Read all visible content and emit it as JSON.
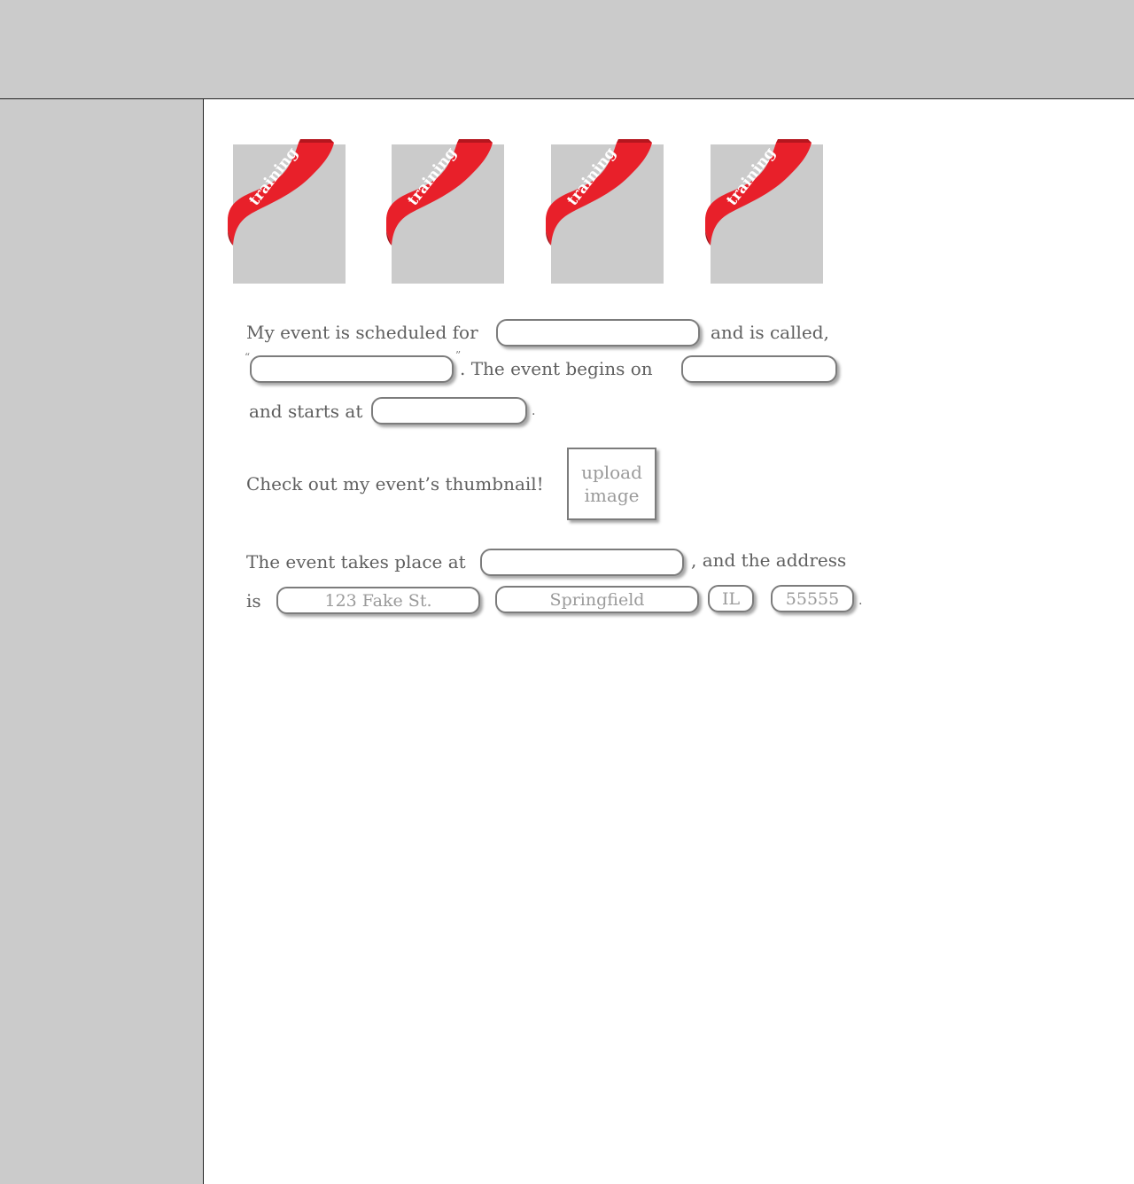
{
  "cards": [
    {
      "ribbon_label": "training",
      "ribbon_color": "#e8202a"
    },
    {
      "ribbon_label": "training",
      "ribbon_color": "#e8202a"
    },
    {
      "ribbon_label": "training",
      "ribbon_color": "#e8202a"
    },
    {
      "ribbon_label": "training",
      "ribbon_color": "#e8202a"
    }
  ],
  "form": {
    "line1_prefix": "My event is scheduled for",
    "line1_suffix": "and is called,",
    "open_quote": "“",
    "close_quote": "”",
    "line2_mid": ". The event begins on",
    "line3_prefix": "and starts at",
    "period": ".",
    "thumbnail_label": "Check out my event’s thumbnail!",
    "upload_line1": "upload",
    "upload_line2": "image",
    "location_prefix": "The event takes place at",
    "location_suffix": ", and the address",
    "address_prefix": "is",
    "street_placeholder": "123 Fake St.",
    "city_placeholder": "Springfield",
    "state_placeholder": "IL",
    "zip_placeholder": "55555"
  },
  "colors": {
    "panel_gray": "#cbcbcb",
    "ribbon_red": "#e8202a",
    "text": "#5f5f5f",
    "field_border": "#7c7c7c"
  }
}
